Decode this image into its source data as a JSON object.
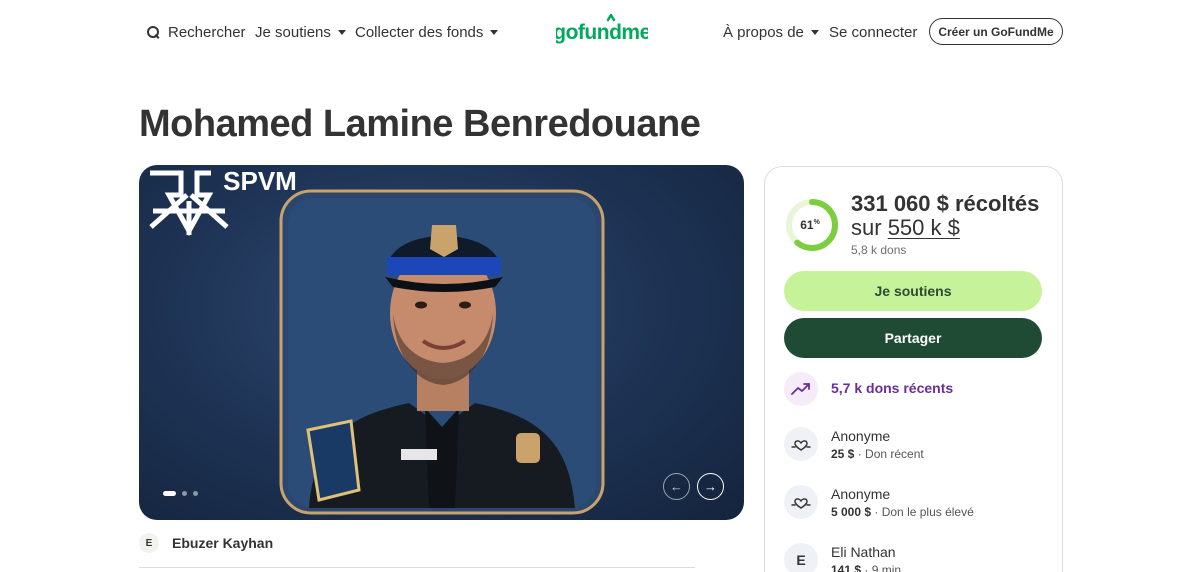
{
  "header": {
    "search_label": "Rechercher",
    "support_label": "Je soutiens",
    "fundraise_label": "Collecter des fonds",
    "logo_text": "gofundme",
    "about_label": "À propos de",
    "login_label": "Se connecter",
    "create_label": "Créer un GoFundMe"
  },
  "campaign": {
    "title": "Mohamed Lamine Benredouane",
    "hero": {
      "badge_text": "SPVM",
      "slides": 3,
      "active_slide": 1
    },
    "organizer": {
      "initial": "E",
      "name": "Ebuzer Kayhan"
    }
  },
  "sidebar": {
    "progress_percent": 61,
    "progress_label": "61",
    "progress_unit": "%",
    "raised": "331 060 $ récoltés",
    "goal_prefix": "sur",
    "goal_amount": "550 k $",
    "donation_count": "5,8 k dons",
    "donate_label": "Je soutiens",
    "share_label": "Partager",
    "recent_label": "5,7 k dons récents",
    "donations": [
      {
        "name": "Anonyme",
        "amount": "25 $",
        "detail": "· Don récent",
        "icon": "hand-heart-icon"
      },
      {
        "name": "Anonyme",
        "amount": "5 000 $",
        "detail": "· Don le plus élevé",
        "icon": "hand-heart-icon"
      },
      {
        "name": "Eli Nathan",
        "initial": "E",
        "amount": "141 $",
        "detail": "· 9 min"
      }
    ]
  },
  "colors": {
    "text": "#333333",
    "accent_green": "#c6f29a",
    "dark_green": "#1f4a33",
    "brand_green": "#02a95c",
    "trend_purple": "#6a2e9a"
  }
}
